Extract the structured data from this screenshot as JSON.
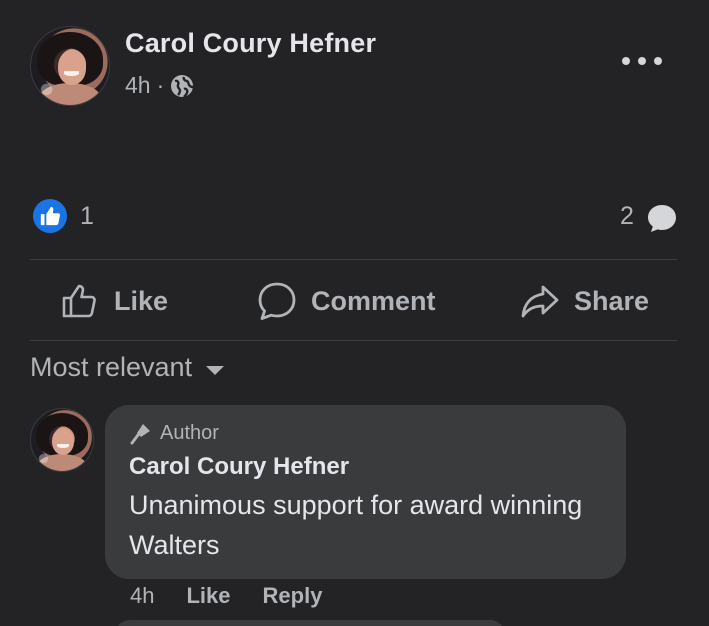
{
  "post": {
    "author": "Carol Coury Hefner",
    "time": "4h",
    "separator": "·",
    "privacy_icon": "globe-icon",
    "more_icon": "more-options-icon"
  },
  "reactions": {
    "like_count": "1",
    "comment_count": "2",
    "like_color": "#1b74e4"
  },
  "actions": {
    "like": "Like",
    "comment": "Comment",
    "share": "Share"
  },
  "comments_sort": {
    "label": "Most relevant"
  },
  "comments": [
    {
      "badge": "Author",
      "author": "Carol Coury Hefner",
      "text": "Unanimous support for award winning Walters",
      "time": "4h",
      "like": "Like",
      "reply": "Reply"
    }
  ],
  "colors": {
    "background": "#232325",
    "bubble": "#3a3b3d",
    "text_primary": "#e4e6eb",
    "text_secondary": "#b0b3b8"
  }
}
